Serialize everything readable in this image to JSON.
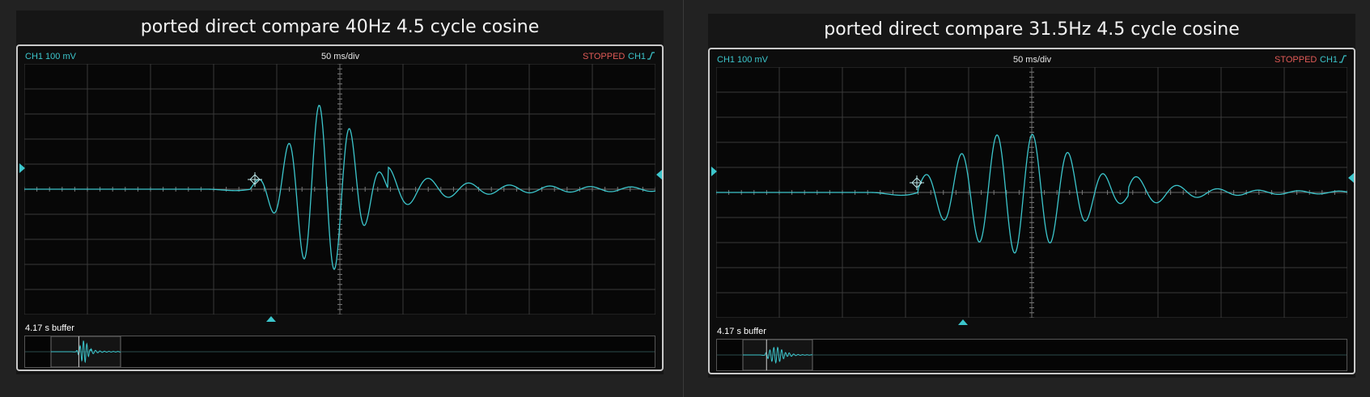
{
  "windows": [
    {
      "title": "ported direct compare 40Hz 4.5 cycle cosine",
      "channel_label": "CH1 100 mV",
      "timebase_label": "50 ms/div",
      "status_label": "STOPPED",
      "trigger_label": "CH1",
      "buffer_label": "4.17 s buffer",
      "trace_color": "#3cc6cc",
      "status_color": "#e05a56"
    },
    {
      "title": "ported direct compare 31.5Hz 4.5 cycle cosine",
      "channel_label": "CH1 100 mV",
      "timebase_label": "50 ms/div",
      "status_label": "STOPPED",
      "trigger_label": "CH1",
      "buffer_label": "4.17 s buffer",
      "trace_color": "#3cc6cc",
      "status_color": "#e05a56"
    }
  ],
  "icons": [
    "trigger-rising-edge-icon",
    "trigger-level-marker-icon",
    "trigger-position-marker-icon",
    "trigger-point-marker-icon"
  ]
}
